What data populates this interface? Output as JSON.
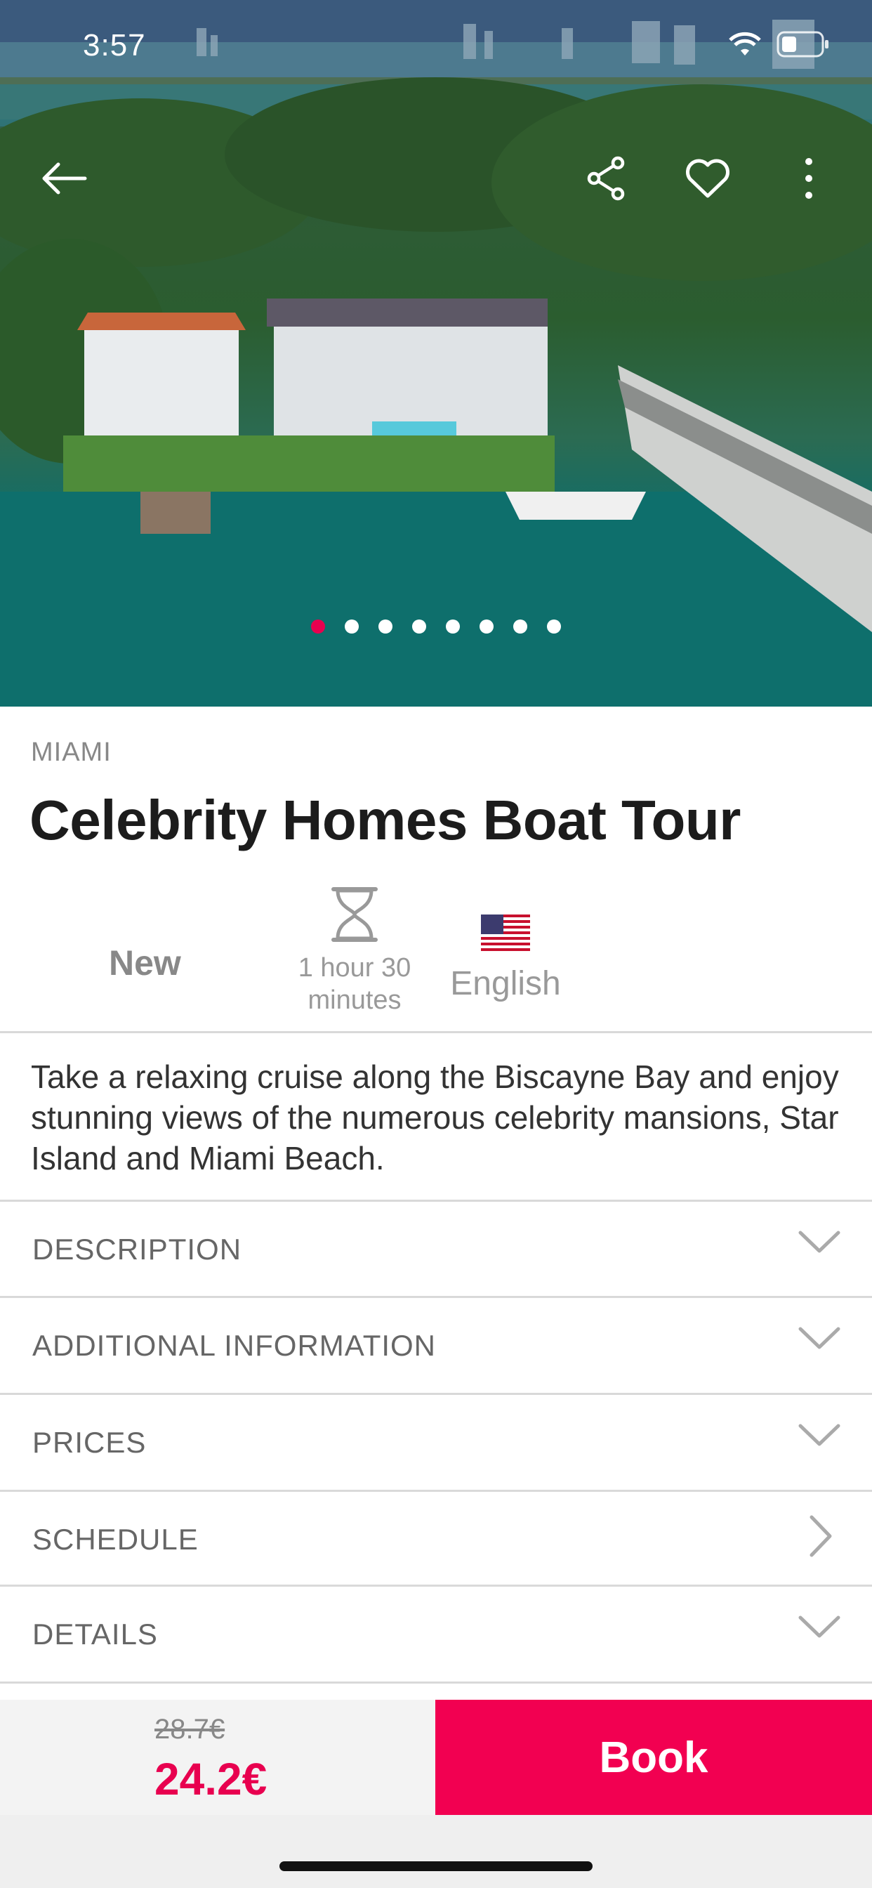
{
  "status_bar": {
    "time": "3:57"
  },
  "hero": {
    "image_description_icon": "aerial-photo-icon",
    "dots_total": 8,
    "active_dot": 0,
    "accent_color": "#e8004f"
  },
  "tour": {
    "city": "MIAMI",
    "title": "Celebrity Homes Boat Tour",
    "badge": "New",
    "duration_line1": "1 hour 30",
    "duration_line2": "minutes",
    "language": "English",
    "summary": "Take a relaxing cruise along the Biscayne Bay and enjoy stunning views of the numerous celebrity mansions, Star Island and Miami Beach."
  },
  "sections": [
    {
      "label": "DESCRIPTION",
      "icon": "chevron-down-icon"
    },
    {
      "label": "ADDITIONAL INFORMATION",
      "icon": "chevron-down-icon"
    },
    {
      "label": "PRICES",
      "icon": "chevron-down-icon"
    },
    {
      "label": "SCHEDULE",
      "icon": "chevron-right-icon"
    },
    {
      "label": "DETAILS",
      "icon": "chevron-down-icon"
    }
  ],
  "booking": {
    "old_price": "28.7€",
    "price": "24.2€",
    "book_label": "Book",
    "brand_color": "#f20051"
  }
}
